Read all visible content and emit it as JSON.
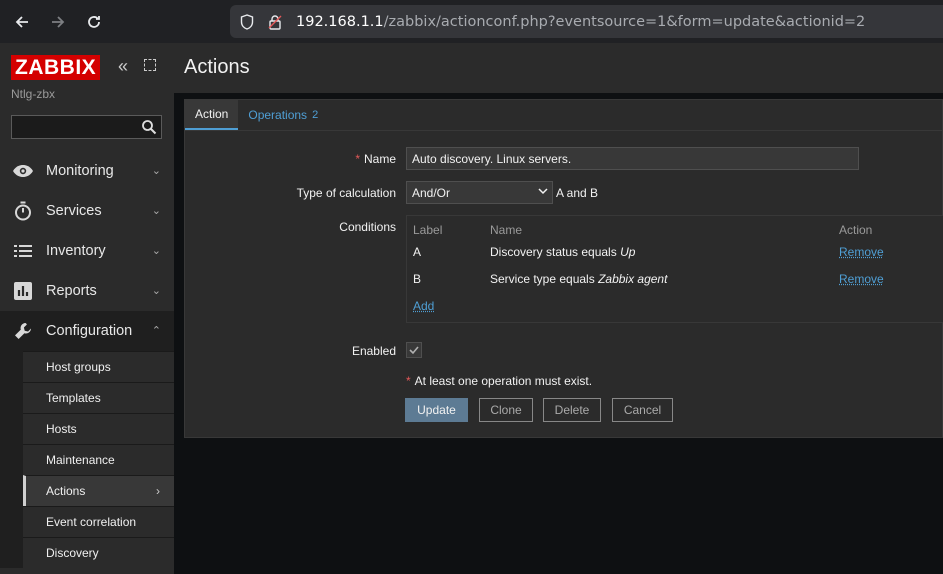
{
  "browser": {
    "url_host": "192.168.1.1",
    "url_path": "/zabbix/actionconf.php?eventsource=1&form=update&actionid=2"
  },
  "sidebar": {
    "logo": "ZABBIX",
    "server_name": "Ntlg-zbx",
    "search_value": "",
    "menu": [
      {
        "label": "Monitoring",
        "icon": "eye-icon"
      },
      {
        "label": "Services",
        "icon": "stopwatch-icon"
      },
      {
        "label": "Inventory",
        "icon": "list-icon"
      },
      {
        "label": "Reports",
        "icon": "bar-chart-icon"
      },
      {
        "label": "Configuration",
        "icon": "wrench-icon"
      }
    ],
    "configuration_items": [
      "Host groups",
      "Templates",
      "Hosts",
      "Maintenance",
      "Actions",
      "Event correlation",
      "Discovery"
    ]
  },
  "page": {
    "title": "Actions",
    "tabs": [
      {
        "label": "Action"
      },
      {
        "label": "Operations",
        "badge": "2"
      }
    ]
  },
  "form": {
    "name_label": "Name",
    "name_required": "*",
    "name_value": "Auto discovery. Linux servers.",
    "calc_label": "Type of calculation",
    "calc_value": "And/Or",
    "calc_formula": "A and B",
    "conditions_label": "Conditions",
    "cond_headers": {
      "label": "Label",
      "name": "Name",
      "action": "Action"
    },
    "conditions": [
      {
        "label": "A",
        "text": "Discovery status equals ",
        "value": "Up",
        "action": "Remove"
      },
      {
        "label": "B",
        "text": "Service type equals ",
        "value": "Zabbix agent",
        "action": "Remove"
      }
    ],
    "add_link": "Add",
    "enabled_label": "Enabled",
    "warning_star": "*",
    "warning": "At least one operation must exist.",
    "buttons": {
      "update": "Update",
      "clone": "Clone",
      "delete": "Delete",
      "cancel": "Cancel"
    }
  },
  "colors": {
    "accent": "#4f9fd5",
    "logo_red": "#d40000",
    "primary_button": "#5d7b94"
  }
}
